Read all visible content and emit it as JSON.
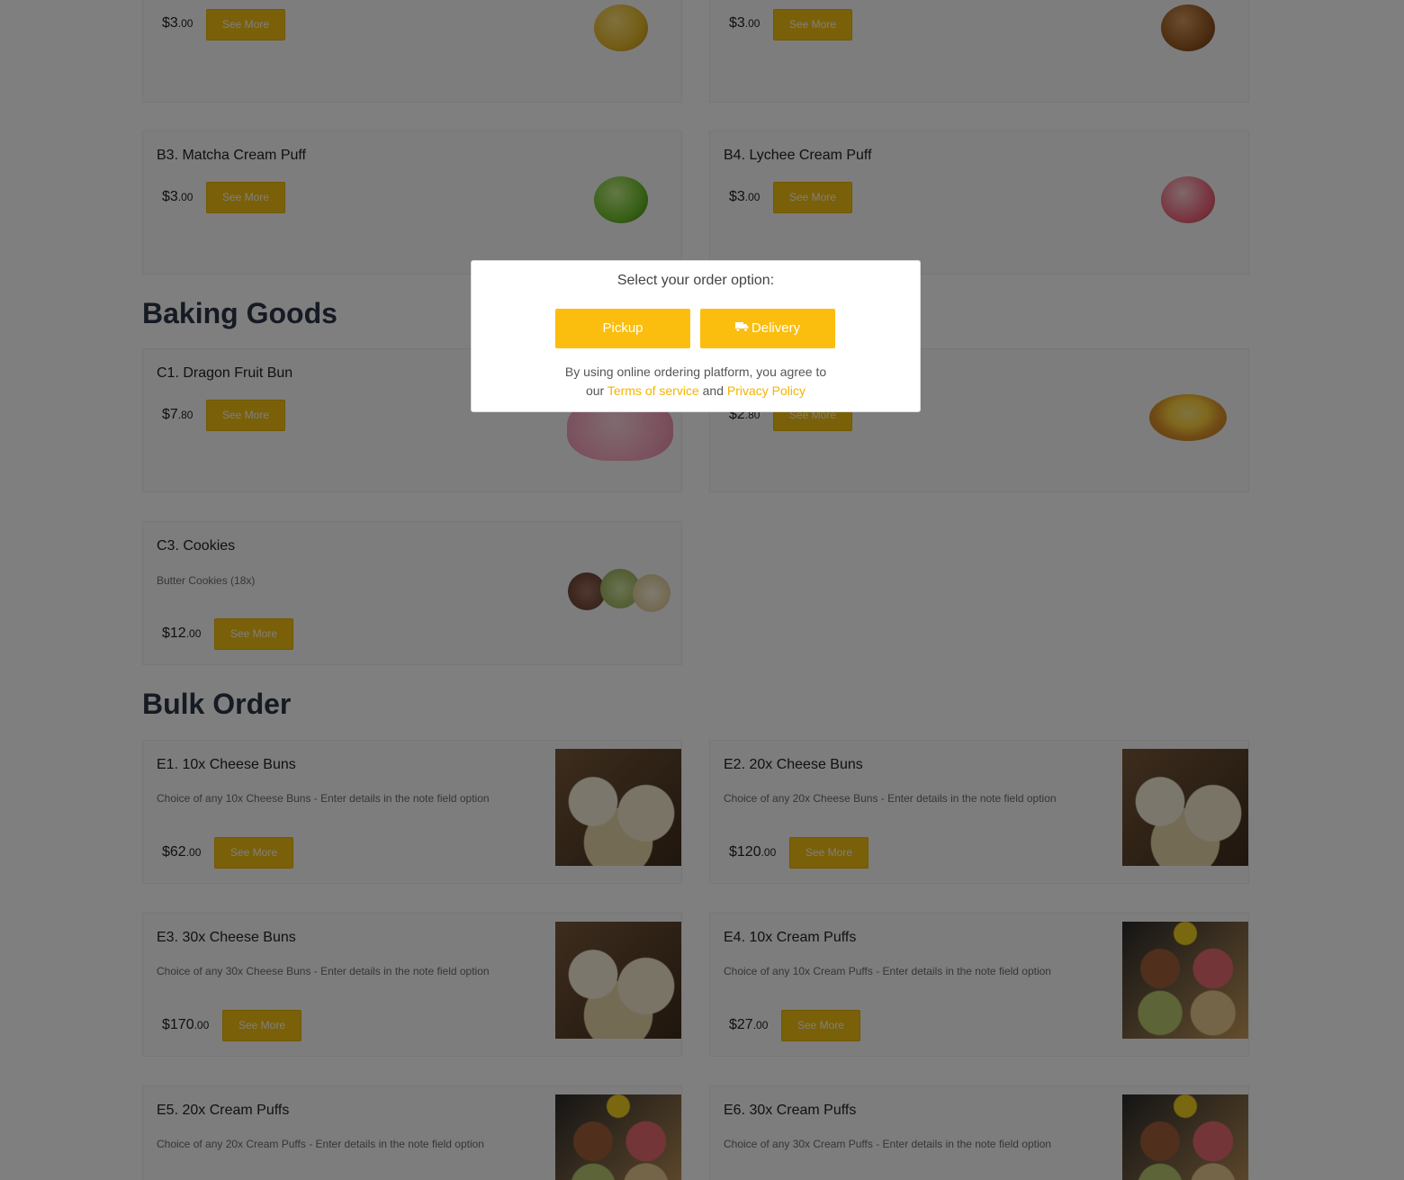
{
  "colors": {
    "accent": "#f5c010",
    "overlay": "rgba(0,0,0,0.5)",
    "title": "#2a3547"
  },
  "sections": {
    "baking_goods": "Baking Goods",
    "bulk_order": "Bulk Order"
  },
  "items": {
    "b1": {
      "price_main": "$3",
      "price_cents": ".00",
      "button": "See More",
      "image": "yellow-cream-puff"
    },
    "b2": {
      "price_main": "$3",
      "price_cents": ".00",
      "button": "See More",
      "image": "chocolate-cream-puff"
    },
    "b3": {
      "name": "B3. Matcha Cream Puff",
      "price_main": "$3",
      "price_cents": ".00",
      "button": "See More",
      "image": "matcha-cream-puff"
    },
    "b4": {
      "name": "B4. Lychee Cream Puff",
      "price_main": "$3",
      "price_cents": ".00",
      "button": "See More",
      "image": "lychee-cream-puff"
    },
    "c1": {
      "name": "C1. Dragon Fruit Bun",
      "price_main": "$7",
      "price_cents": ".80",
      "button": "See More",
      "image": "dragon-fruit-bun"
    },
    "c2": {
      "price_main": "$2",
      "price_cents": ".80",
      "button": "See More",
      "image": "egg-tart"
    },
    "c3": {
      "name": "C3. Cookies",
      "desc": "Butter Cookies (18x)",
      "price_main": "$12",
      "price_cents": ".00",
      "button": "See More",
      "image": "butter-cookies"
    },
    "e1": {
      "name": "E1. 10x Cheese Buns",
      "desc": "Choice of any 10x Cheese Buns - Enter details in the note field option",
      "price_main": "$62",
      "price_cents": ".00",
      "button": "See More",
      "image": "cheese-buns-photo"
    },
    "e2": {
      "name": "E2. 20x Cheese Buns",
      "desc": "Choice of any 20x Cheese Buns - Enter details in the note field option",
      "price_main": "$120",
      "price_cents": ".00",
      "button": "See More",
      "image": "cheese-buns-photo"
    },
    "e3": {
      "name": "E3. 30x Cheese Buns",
      "desc": "Choice of any 30x Cheese Buns - Enter details in the note field option",
      "price_main": "$170",
      "price_cents": ".00",
      "button": "See More",
      "image": "cheese-buns-photo"
    },
    "e4": {
      "name": "E4. 10x Cream Puffs",
      "desc": "Choice of any 10x Cream Puffs - Enter details in the note field option",
      "price_main": "$27",
      "price_cents": ".00",
      "button": "See More",
      "image": "cream-puffs-photo"
    },
    "e5": {
      "name": "E5. 20x Cream Puffs",
      "desc": "Choice of any 20x Cream Puffs - Enter details in the note field option",
      "image": "cream-puffs-photo"
    },
    "e6": {
      "name": "E6. 30x Cream Puffs",
      "desc": "Choice of any 30x Cream Puffs - Enter details in the note field option",
      "image": "cream-puffs-photo"
    }
  },
  "modal": {
    "title": "Select your order option:",
    "pickup": "Pickup",
    "delivery": "Delivery",
    "delivery_icon": "truck-icon",
    "terms_line1": "By using online ordering platform, you agree to",
    "terms_our": "our",
    "terms_link": "Terms of service",
    "terms_and": "and",
    "privacy_link": "Privacy Policy"
  }
}
